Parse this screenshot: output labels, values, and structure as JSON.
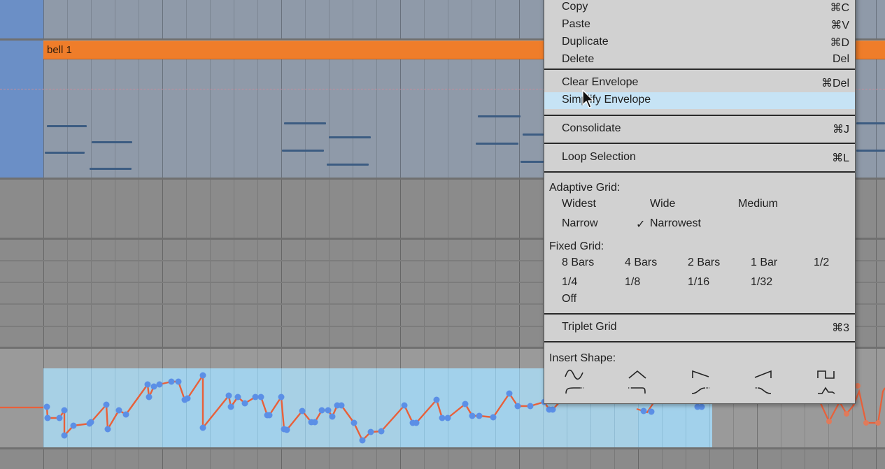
{
  "clip": {
    "name": "bell 1"
  },
  "menu": {
    "items_top": [
      {
        "label": "Copy",
        "shortcut": "⌘C"
      },
      {
        "label": "Paste",
        "shortcut": "⌘V"
      },
      {
        "label": "Duplicate",
        "shortcut": "⌘D"
      },
      {
        "label": "Delete",
        "shortcut": "Del"
      }
    ],
    "envelope_items": [
      {
        "label": "Clear Envelope",
        "shortcut": "⌘Del"
      },
      {
        "label": "Simplify Envelope",
        "shortcut": ""
      }
    ],
    "consolidate": {
      "label": "Consolidate",
      "shortcut": "⌘J"
    },
    "loop_selection": {
      "label": "Loop Selection",
      "shortcut": "⌘L"
    },
    "adaptive_grid": {
      "header": "Adaptive Grid:",
      "options": [
        "Widest",
        "Wide",
        "Medium",
        "Narrow",
        "Narrowest"
      ],
      "selected": "Narrowest",
      "check": "✓"
    },
    "fixed_grid": {
      "header": "Fixed Grid:",
      "options": [
        "8 Bars",
        "4 Bars",
        "2 Bars",
        "1 Bar",
        "1/2",
        "1/4",
        "1/8",
        "1/16",
        "1/32",
        "Off"
      ]
    },
    "triplet_grid": {
      "label": "Triplet Grid",
      "shortcut": "⌘3"
    },
    "insert_shape": {
      "header": "Insert Shape:",
      "shapes": [
        "sine-shape-icon",
        "triangle-shape-icon",
        "saw-down-shape-icon",
        "saw-up-shape-icon",
        "square-shape-icon",
        "ramp-shape-icon",
        "step-down-shape-icon",
        "s-curve-up-shape-icon",
        "s-curve-down-shape-icon",
        "adsr-shape-icon"
      ]
    },
    "highlight_color": "#c6e3f5"
  },
  "colors": {
    "clip_header": "#ef7d2a",
    "automation_line": "#e8603a",
    "breakpoint": "#5b8fe6",
    "selection": "#a9d9f2"
  }
}
